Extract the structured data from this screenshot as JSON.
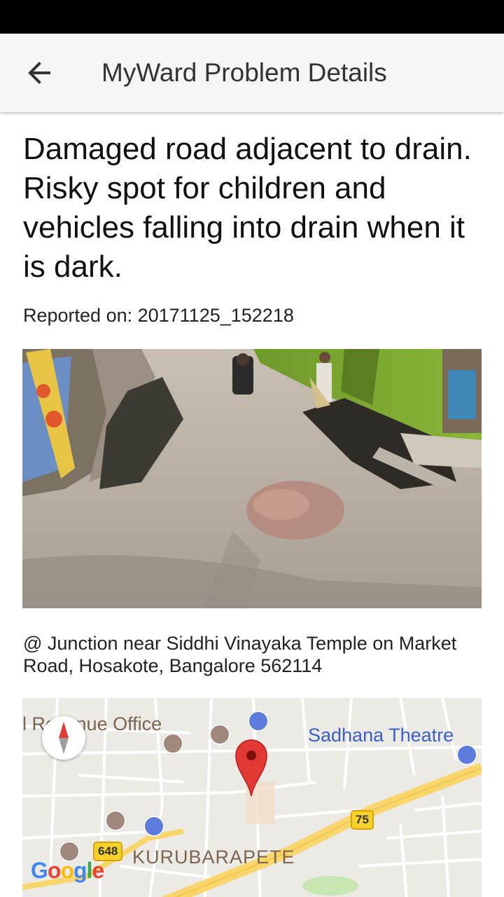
{
  "app_bar": {
    "title": "MyWard Problem Details",
    "back_icon": "arrow-back-icon"
  },
  "problem": {
    "title": "Damaged road adjacent to drain. Risky spot for children and vehicles falling into drain when it is dark.",
    "reported_on": "Reported on: 20171125_152218",
    "address": "@ Junction near Siddhi Vinayaka Temple on Market Road, Hosakote, Bangalore 562114"
  },
  "map": {
    "labels": {
      "revenue_office": "l Revenue Office",
      "sadhana_theatre": "Sadhana Theatre",
      "kurubarapete": "KURUBARAPETE"
    },
    "route_shields": [
      "75",
      "648"
    ],
    "logo": [
      "G",
      "o",
      "o",
      "g",
      "l",
      "e"
    ],
    "colors": {
      "marker": "#e53935",
      "highway": "#f8d66b",
      "label_blue": "#3b5fc4",
      "map_background": "#eceae4"
    }
  }
}
